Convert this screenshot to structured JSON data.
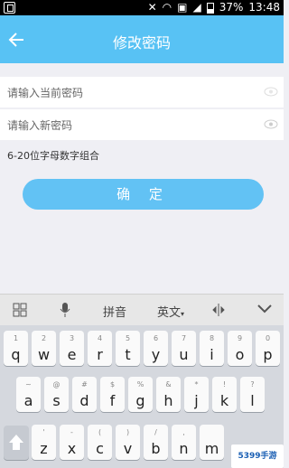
{
  "status_bar": {
    "battery": "37%",
    "time": "13:48"
  },
  "header": {
    "title": "修改密码"
  },
  "form": {
    "current_password_placeholder": "请输入当前密码",
    "new_password_placeholder": "请输入新密码",
    "hint": "6-20位字母数字组合",
    "confirm_label": "确 定"
  },
  "keyboard_toolbar": {
    "pinyin": "拼音",
    "lang": "英文"
  },
  "keyboard": {
    "row1": [
      {
        "n": "1",
        "c": "q"
      },
      {
        "n": "2",
        "c": "w"
      },
      {
        "n": "3",
        "c": "e"
      },
      {
        "n": "4",
        "c": "r"
      },
      {
        "n": "5",
        "c": "t"
      },
      {
        "n": "6",
        "c": "y"
      },
      {
        "n": "7",
        "c": "u"
      },
      {
        "n": "8",
        "c": "i"
      },
      {
        "n": "9",
        "c": "o"
      },
      {
        "n": "0",
        "c": "p"
      }
    ],
    "row2": [
      {
        "n": "~",
        "c": "a"
      },
      {
        "n": "@",
        "c": "s"
      },
      {
        "n": "#",
        "c": "d"
      },
      {
        "n": "$",
        "c": "f"
      },
      {
        "n": "%",
        "c": "g"
      },
      {
        "n": "&",
        "c": "h"
      },
      {
        "n": "*",
        "c": "j"
      },
      {
        "n": "!",
        "c": "k"
      },
      {
        "n": "?",
        "c": "l"
      }
    ],
    "row3": [
      {
        "n": "'",
        "c": "z"
      },
      {
        "n": "-",
        "c": "x"
      },
      {
        "n": "(",
        "c": "c"
      },
      {
        "n": ")",
        "c": "v"
      },
      {
        "n": "/",
        "c": "b"
      },
      {
        "n": ",",
        "c": "n"
      },
      {
        "n": "",
        "c": "m"
      }
    ]
  },
  "watermark": "5399手游"
}
